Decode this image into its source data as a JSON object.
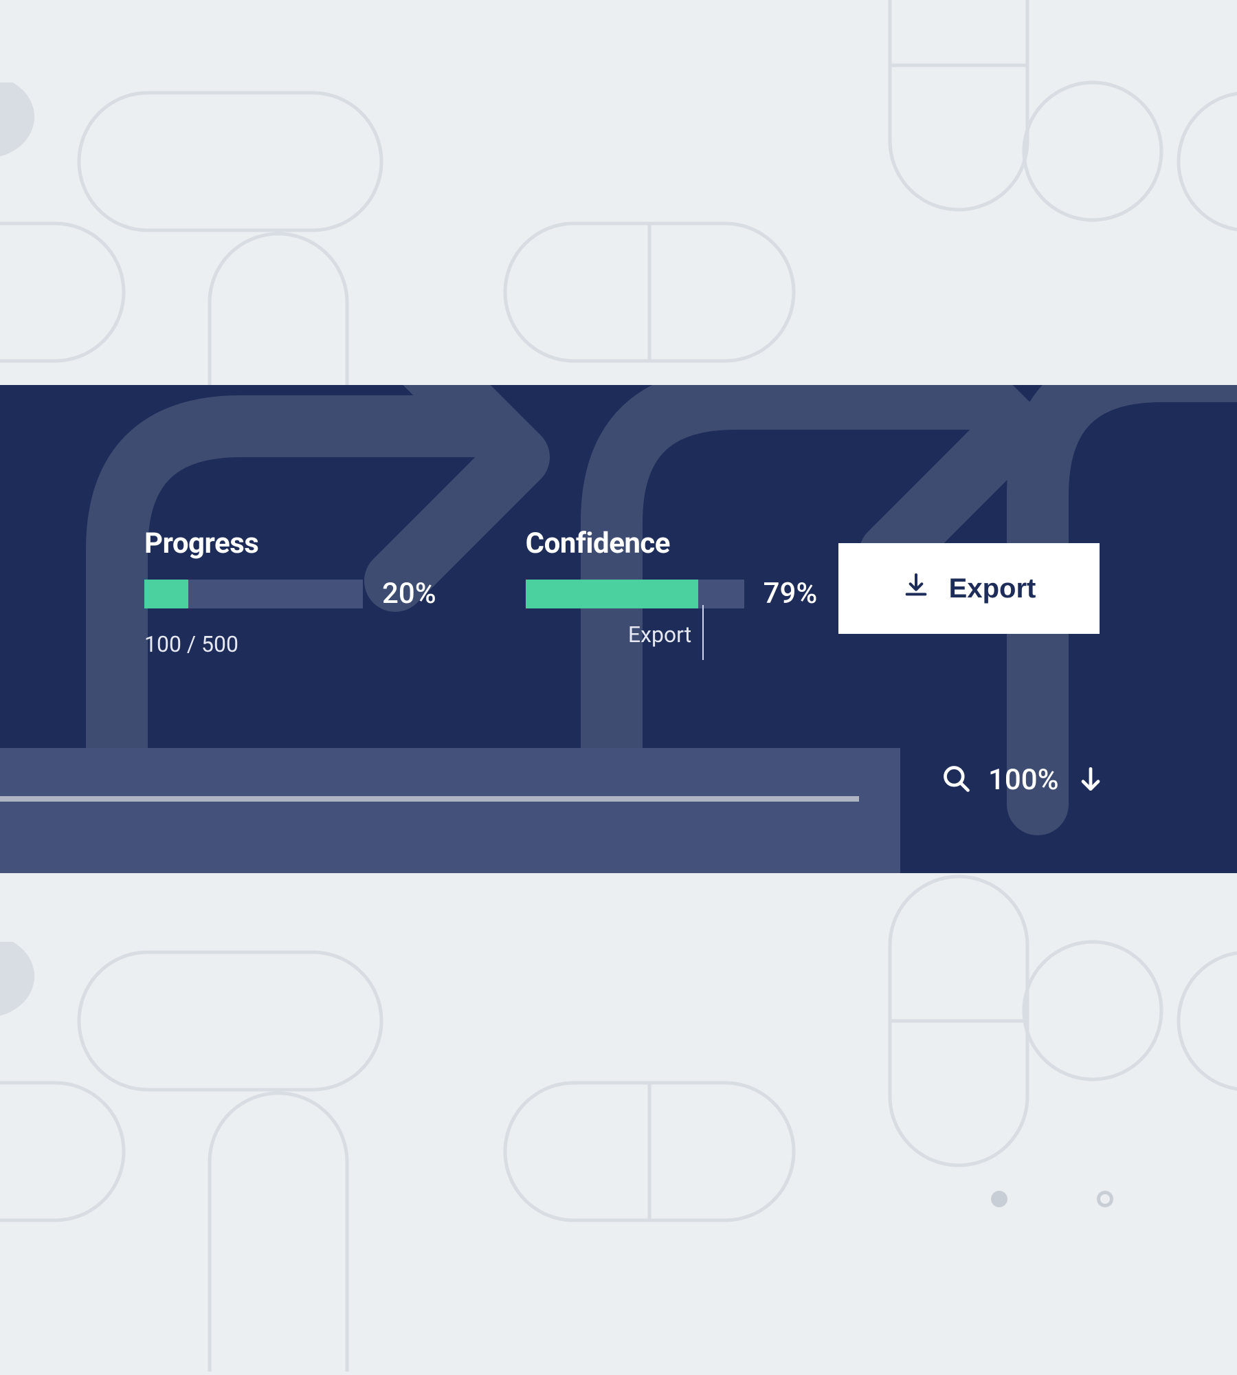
{
  "metrics": {
    "progress": {
      "title": "Progress",
      "pct_label": "20%",
      "pct_value": 20,
      "sub": "100 / 500"
    },
    "confidence": {
      "title": "Confidence",
      "pct_label": "79%",
      "pct_value": 79,
      "tooltip_label": "Export",
      "tooltip_pos_pct": 81
    }
  },
  "export_button": {
    "label": "Export"
  },
  "zoom": {
    "pct_label": "100%"
  },
  "colors": {
    "banner_bg": "#1d2c58",
    "bar_track": "#44517a",
    "bar_fill": "#4bd1a0",
    "page_bg": "#eceff2"
  }
}
